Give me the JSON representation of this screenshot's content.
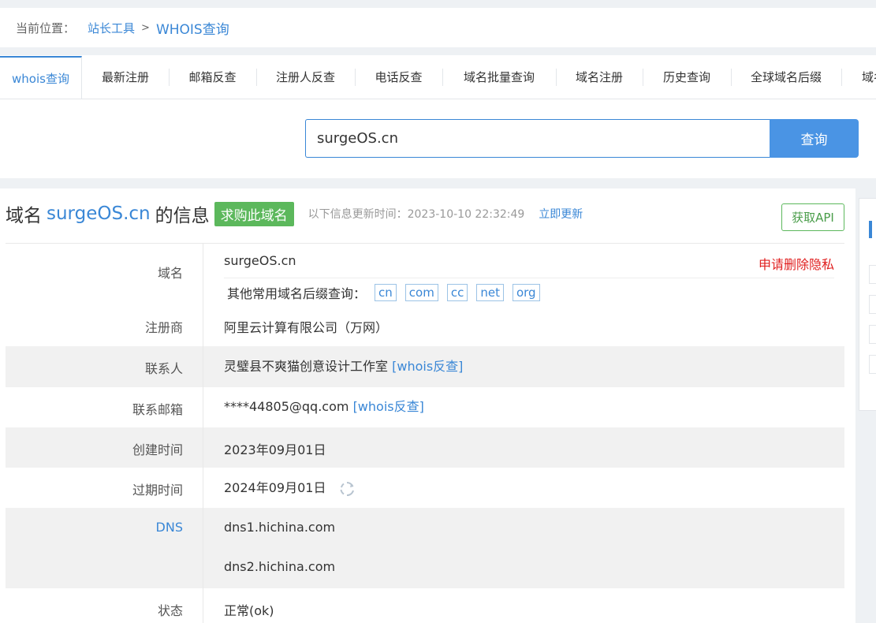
{
  "breadcrumb": {
    "label": "当前位置：",
    "items": [
      "站长工具",
      "WHOIS查询"
    ],
    "separator": ">"
  },
  "tabs": [
    {
      "label": "whois查询",
      "active": true
    },
    {
      "label": "最新注册"
    },
    {
      "label": "邮箱反查"
    },
    {
      "label": "注册人反查"
    },
    {
      "label": "电话反查"
    },
    {
      "label": "域名批量查询"
    },
    {
      "label": "域名注册"
    },
    {
      "label": "历史查询"
    },
    {
      "label": "全球域名后缀"
    },
    {
      "label": "域名"
    }
  ],
  "search": {
    "value": "surgeOS.cn",
    "button_label": "查询"
  },
  "info": {
    "title_prefix": "域名",
    "domain": "surgeOS.cn",
    "title_suffix": "的信息",
    "buy_label": "求购此域名",
    "updated_text": "以下信息更新时间：2023-10-10 22:32:49",
    "update_link": "立即更新",
    "api_label": "获取API"
  },
  "rows": {
    "domain": {
      "label": "域名",
      "value": "surgeOS.cn",
      "privacy_link": "申请删除隐私",
      "suffix_label": "其他常用域名后缀查询：",
      "suffixes": [
        "cn",
        "com",
        "cc",
        "net",
        "org"
      ]
    },
    "registrar": {
      "label": "注册商",
      "value": "阿里云计算有限公司（万网）"
    },
    "contact": {
      "label": "联系人",
      "value": "灵璧县不爽猫创意设计工作室",
      "link": "[whois反查]"
    },
    "email": {
      "label": "联系邮箱",
      "value": "****44805@qq.com",
      "link": "[whois反查]"
    },
    "created": {
      "label": "创建时间",
      "value": "2023年09月01日"
    },
    "expires": {
      "label": "过期时间",
      "value": "2024年09月01日"
    },
    "dns": {
      "label": "DNS",
      "values": [
        "dns1.hichina.com",
        "dns2.hichina.com"
      ]
    },
    "status": {
      "label": "状态",
      "value": "正常(ok)"
    }
  },
  "colors": {
    "accent": "#3a87d6",
    "buy_badge": "#5cb85c",
    "privacy": "#e02020"
  }
}
